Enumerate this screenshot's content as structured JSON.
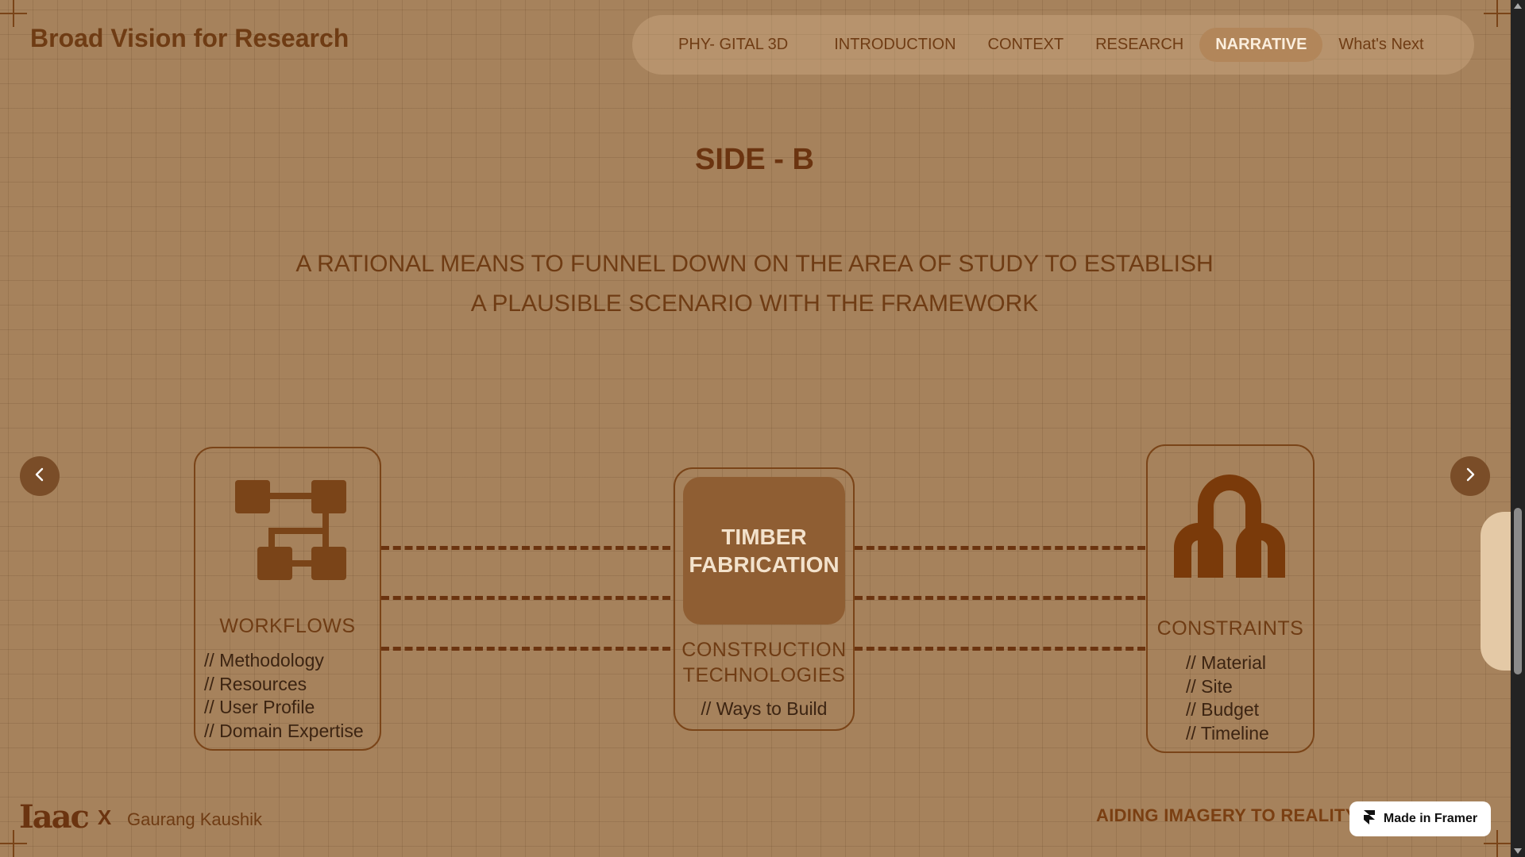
{
  "header": {
    "brand": "Broad Vision for Research",
    "nav": [
      {
        "label": "PHY- GITAL 3D",
        "active": false
      },
      {
        "label": "INTRODUCTION",
        "active": false
      },
      {
        "label": "CONTEXT",
        "active": false
      },
      {
        "label": "RESEARCH",
        "active": false
      },
      {
        "label": "NARRATIVE",
        "active": true
      },
      {
        "label": "What's Next",
        "active": false
      }
    ]
  },
  "main": {
    "title": "SIDE - B",
    "subtitle_line1": "A RATIONAL MEANS TO FUNNEL DOWN ON THE AREA OF STUDY TO ESTABLISH",
    "subtitle_line2": "A PLAUSIBLE SCENARIO WITH THE FRAMEWORK"
  },
  "cards": {
    "workflows": {
      "icon": "workflow-icon",
      "label": "WORKFLOWS",
      "items": [
        "// Methodology",
        "// Resources",
        "// User Profile",
        "// Domain Expertise"
      ]
    },
    "center": {
      "highlight_line1": "TIMBER",
      "highlight_line2": "FABRICATION",
      "label_line1": "CONSTRUCTION",
      "label_line2": "TECHNOLOGIES",
      "items": [
        "// Ways to Build"
      ]
    },
    "constraints": {
      "icon": "constraints-icon",
      "label": "CONSTRAINTS",
      "items": [
        "// Material",
        "// Site",
        "// Budget",
        "// Timeline"
      ]
    }
  },
  "carousel": {
    "prev_icon": "chevron-left-icon",
    "next_icon": "chevron-right-icon"
  },
  "footer": {
    "logo_text": "Iaac",
    "x_text": "X",
    "author": "Gaurang Kaushik",
    "tagline": "AIDING IMAGERY TO REALITY",
    "badge": "Made in Framer"
  },
  "colors": {
    "background": "#a6825c",
    "accent_dark": "#6b3410",
    "highlight_box": "#8f5e33",
    "nav_active": "#b2865a"
  }
}
